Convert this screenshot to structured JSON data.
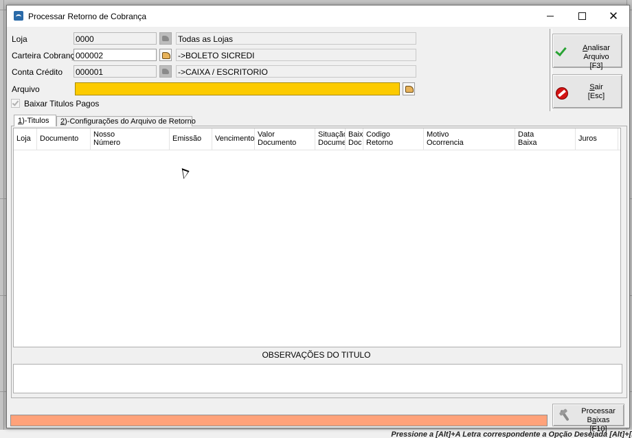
{
  "window": {
    "title": "Processar Retorno de Cobrança",
    "minimize": "minimize",
    "maximize": "maximize",
    "close": "close"
  },
  "form": {
    "loja_label": "Loja",
    "loja_code": "0000",
    "loja_desc": "Todas as Lojas",
    "carteira_label": "Carteira Cobrança",
    "carteira_code": "000002",
    "carteira_desc": "->BOLETO SICREDI",
    "conta_label": "Conta Crédito",
    "conta_code": "000001",
    "conta_desc": "->CAIXA / ESCRITORIO",
    "arquivo_label": "Arquivo",
    "arquivo_value": "",
    "baixar_label": "Baixar Titulos Pagos",
    "baixar_checked": true
  },
  "buttons": {
    "analisar_line1_prefix": "A",
    "analisar_line1_rest": "nalisar Arquivo",
    "analisar_line2": "[F3]",
    "sair_prefix": "S",
    "sair_rest": "air",
    "sair_line2": "[Esc]",
    "processar_prefix": "Processar B",
    "processar_accel": "a",
    "processar_rest": "ixas",
    "processar_line2": "[F10]"
  },
  "tabs": {
    "titulos_prefix": "1",
    "titulos_rest": ")-Titulos",
    "config_prefix": "2",
    "config_rest": ")-Configurações do Arquivo de Retorno"
  },
  "grid": {
    "col_loja": "Loja",
    "col_documento": "Documento",
    "col_nosso_1": "Nosso",
    "col_nosso_2": "Número",
    "col_emissao": "Emissão",
    "col_vencimento": "Vencimento",
    "col_valor_1": "Valor",
    "col_valor_2": "Documento",
    "col_situacao_1": "Situação",
    "col_situacao_2": "Docume",
    "col_baixa_1": "Baix",
    "col_baixa_2": "Doc",
    "col_codigo_1": "Codigo",
    "col_codigo_2": "Retorno",
    "col_motivo_1": "Motivo",
    "col_motivo_2": "Ocorrencia",
    "col_data_1": "Data",
    "col_data_2": "Baixa",
    "col_juros": "Juros",
    "rows": []
  },
  "observacoes": {
    "title": "OBSERVAÇÕES DO TITULO",
    "text": ""
  },
  "status": {
    "hint": "Pressione a [Alt]+A Letra correspondente a Opção Desejada  [Alt]+[I]"
  },
  "colors": {
    "arquivo_bg": "#fccb00",
    "progress_bg": "#ffa27a",
    "check_green": "#29a334",
    "stop_red": "#d41414"
  },
  "icons": {
    "app": "app-icon",
    "picker_disabled": "folder-search-icon",
    "picker_enabled": "folder-search-icon",
    "analisar": "check-icon",
    "sair": "stop-icon",
    "processar": "tools-icon"
  }
}
